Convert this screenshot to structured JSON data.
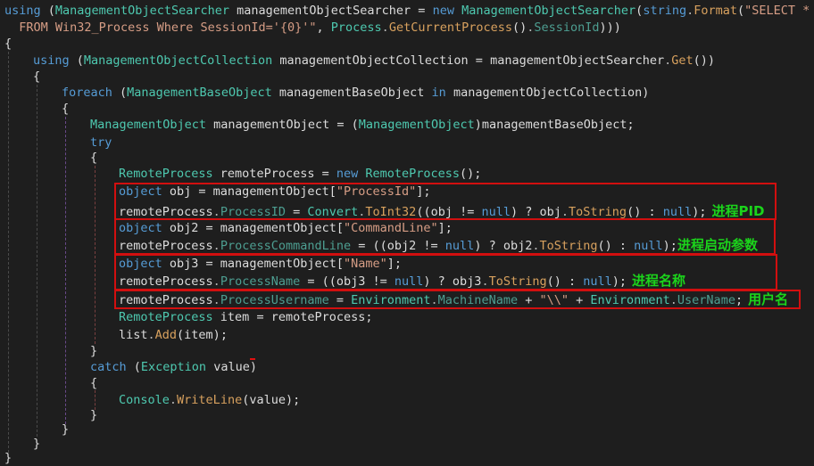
{
  "editor": {
    "lines": [
      {
        "indent": 0,
        "tokens": [
          [
            "k",
            "using"
          ],
          [
            "n",
            " ("
          ],
          [
            "t",
            "ManagementObjectSearcher"
          ],
          [
            "n",
            " managementObjectSearcher = "
          ],
          [
            "k",
            "new"
          ],
          [
            "n",
            " "
          ],
          [
            "t",
            "ManagementObjectSearcher"
          ],
          [
            "n",
            "("
          ],
          [
            "k",
            "string"
          ],
          [
            "g",
            "."
          ],
          [
            "m",
            "Format"
          ],
          [
            "n",
            "("
          ],
          [
            "s",
            "\"SELECT *"
          ]
        ]
      },
      {
        "indent": 0,
        "tokens": [
          [
            "s",
            "  FROM Win32_Process Where SessionId='{0}'\""
          ],
          [
            "n",
            ", "
          ],
          [
            "t",
            "Process"
          ],
          [
            "g",
            "."
          ],
          [
            "m",
            "GetCurrentProcess"
          ],
          [
            "n",
            "()"
          ],
          [
            "g",
            "."
          ],
          [
            "p",
            "SessionId"
          ],
          [
            "n",
            ")))"
          ]
        ]
      },
      {
        "indent": 0,
        "tokens": [
          [
            "n",
            "{"
          ]
        ]
      },
      {
        "indent": 1,
        "tokens": [
          [
            "k",
            "using"
          ],
          [
            "n",
            " ("
          ],
          [
            "t",
            "ManagementObjectCollection"
          ],
          [
            "n",
            " managementObjectCollection = managementObjectSearcher"
          ],
          [
            "g",
            "."
          ],
          [
            "m",
            "Get"
          ],
          [
            "n",
            "())"
          ]
        ]
      },
      {
        "indent": 1,
        "tokens": [
          [
            "n",
            "{"
          ]
        ]
      },
      {
        "indent": 2,
        "tokens": [
          [
            "k",
            "foreach"
          ],
          [
            "n",
            " ("
          ],
          [
            "t",
            "ManagementBaseObject"
          ],
          [
            "n",
            " managementBaseObject "
          ],
          [
            "k",
            "in"
          ],
          [
            "n",
            " managementObjectCollection)"
          ]
        ]
      },
      {
        "indent": 2,
        "tokens": [
          [
            "n",
            "{"
          ]
        ]
      },
      {
        "indent": 3,
        "tokens": [
          [
            "t",
            "ManagementObject"
          ],
          [
            "n",
            " managementObject = ("
          ],
          [
            "t",
            "ManagementObject"
          ],
          [
            "n",
            ")managementBaseObject;"
          ]
        ]
      },
      {
        "indent": 3,
        "tokens": [
          [
            "k",
            "try"
          ]
        ]
      },
      {
        "indent": 3,
        "tokens": [
          [
            "n",
            "{"
          ]
        ]
      },
      {
        "indent": 4,
        "tokens": [
          [
            "t",
            "RemoteProcess"
          ],
          [
            "n",
            " remoteProcess = "
          ],
          [
            "k",
            "new"
          ],
          [
            "n",
            " "
          ],
          [
            "t",
            "RemoteProcess"
          ],
          [
            "n",
            "();"
          ]
        ]
      },
      {
        "indent": 4,
        "tokens": [
          [
            "k",
            "object"
          ],
          [
            "n",
            " obj = managementObject["
          ],
          [
            "s",
            "\"ProcessId\""
          ],
          [
            "n",
            "];"
          ]
        ]
      },
      {
        "indent": 4,
        "tokens": [
          [
            "n",
            "remoteProcess"
          ],
          [
            "g",
            "."
          ],
          [
            "p",
            "ProcessID"
          ],
          [
            "n",
            " = "
          ],
          [
            "t",
            "Convert"
          ],
          [
            "g",
            "."
          ],
          [
            "m",
            "ToInt32"
          ],
          [
            "n",
            "((obj != "
          ],
          [
            "k",
            "null"
          ],
          [
            "n",
            ") ? obj"
          ],
          [
            "g",
            "."
          ],
          [
            "m",
            "ToString"
          ],
          [
            "n",
            "() : "
          ],
          [
            "k",
            "null"
          ],
          [
            "n",
            ");"
          ]
        ],
        "note": "进程PID"
      },
      {
        "indent": 4,
        "tokens": [
          [
            "k",
            "object"
          ],
          [
            "n",
            " obj2 = managementObject["
          ],
          [
            "s",
            "\"CommandLine\""
          ],
          [
            "n",
            "];"
          ]
        ]
      },
      {
        "indent": 4,
        "tokens": [
          [
            "n",
            "remoteProcess"
          ],
          [
            "g",
            "."
          ],
          [
            "p",
            "ProcessCommandLine"
          ],
          [
            "n",
            " = ((obj2 != "
          ],
          [
            "k",
            "null"
          ],
          [
            "n",
            ") ? obj2"
          ],
          [
            "g",
            "."
          ],
          [
            "m",
            "ToString"
          ],
          [
            "n",
            "() : "
          ],
          [
            "k",
            "null"
          ],
          [
            "n",
            ");"
          ]
        ],
        "note": "进程启动参数"
      },
      {
        "indent": 4,
        "tokens": [
          [
            "k",
            "object"
          ],
          [
            "n",
            " obj3 = managementObject["
          ],
          [
            "s",
            "\"Name\""
          ],
          [
            "n",
            "];"
          ]
        ]
      },
      {
        "indent": 4,
        "tokens": [
          [
            "n",
            "remoteProcess"
          ],
          [
            "g",
            "."
          ],
          [
            "p",
            "ProcessName"
          ],
          [
            "n",
            " = ((obj3 != "
          ],
          [
            "k",
            "null"
          ],
          [
            "n",
            ") ? obj3"
          ],
          [
            "g",
            "."
          ],
          [
            "m",
            "ToString"
          ],
          [
            "n",
            "() : "
          ],
          [
            "k",
            "null"
          ],
          [
            "n",
            ");"
          ]
        ],
        "note": "进程名称"
      },
      {
        "indent": 4,
        "tokens": [
          [
            "n",
            "remoteProcess"
          ],
          [
            "g",
            "."
          ],
          [
            "p",
            "ProcessUsername"
          ],
          [
            "n",
            " = "
          ],
          [
            "t",
            "Environment"
          ],
          [
            "g",
            "."
          ],
          [
            "p",
            "MachineName"
          ],
          [
            "n",
            " + "
          ],
          [
            "s",
            "\"\\\\\""
          ],
          [
            "n",
            " + "
          ],
          [
            "t",
            "Environment"
          ],
          [
            "g",
            "."
          ],
          [
            "p",
            "UserName"
          ],
          [
            "n",
            ";"
          ]
        ],
        "note": "用户名"
      },
      {
        "indent": 4,
        "tokens": [
          [
            "t",
            "RemoteProcess"
          ],
          [
            "n",
            " item = remoteProcess;"
          ]
        ]
      },
      {
        "indent": 4,
        "tokens": [
          [
            "n",
            "list"
          ],
          [
            "g",
            "."
          ],
          [
            "m",
            "Add"
          ],
          [
            "n",
            "(item);"
          ]
        ]
      },
      {
        "indent": 3,
        "tokens": [
          [
            "n",
            "}"
          ]
        ]
      },
      {
        "indent": 3,
        "tokens": [
          [
            "k",
            "catch"
          ],
          [
            "n",
            " ("
          ],
          [
            "t",
            "Exception"
          ],
          [
            "n",
            " value)"
          ]
        ]
      },
      {
        "indent": 3,
        "tokens": [
          [
            "n",
            "{"
          ]
        ]
      },
      {
        "indent": 4,
        "tokens": [
          [
            "t",
            "Console"
          ],
          [
            "g",
            "."
          ],
          [
            "m",
            "WriteLine"
          ],
          [
            "n",
            "(value);"
          ]
        ]
      },
      {
        "indent": 3,
        "tokens": [
          [
            "n",
            "}"
          ]
        ]
      },
      {
        "indent": 2,
        "tokens": [
          [
            "n",
            "}"
          ]
        ]
      },
      {
        "indent": 1,
        "tokens": [
          [
            "n",
            "}"
          ]
        ]
      },
      {
        "indent": 0,
        "tokens": [
          [
            "n",
            "}"
          ]
        ]
      }
    ]
  },
  "colors": {
    "keyword": "#569cd6",
    "type": "#4ec9b0",
    "method": "#d8a15e",
    "string": "#d69d85",
    "annotation": "#1bd41b",
    "highlight_box": "#d20f0f"
  }
}
